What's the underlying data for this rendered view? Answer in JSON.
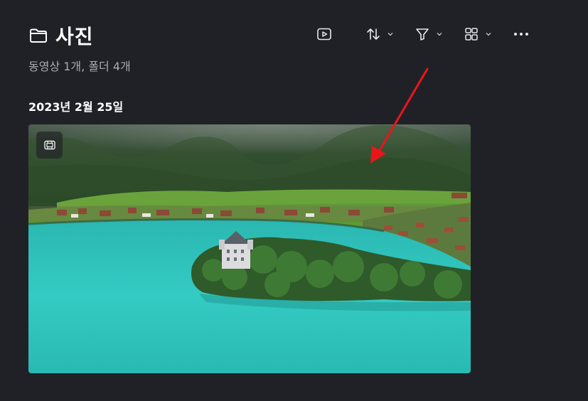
{
  "header": {
    "title": "사진",
    "subtitle": "동영상 1개, 폴더 4개"
  },
  "group": {
    "date": "2023년 2월 25일"
  },
  "colors": {
    "background": "#202127",
    "subtitle": "#a9abb3",
    "annotation_arrow": "#e8161a",
    "lake": "#2fc7bf"
  },
  "toolbar": {
    "icons": [
      "play-icon",
      "sort-icon",
      "filter-icon",
      "view-icon",
      "more-icon"
    ]
  },
  "item": {
    "type": "video",
    "badge_icon": "video-badge-icon"
  }
}
